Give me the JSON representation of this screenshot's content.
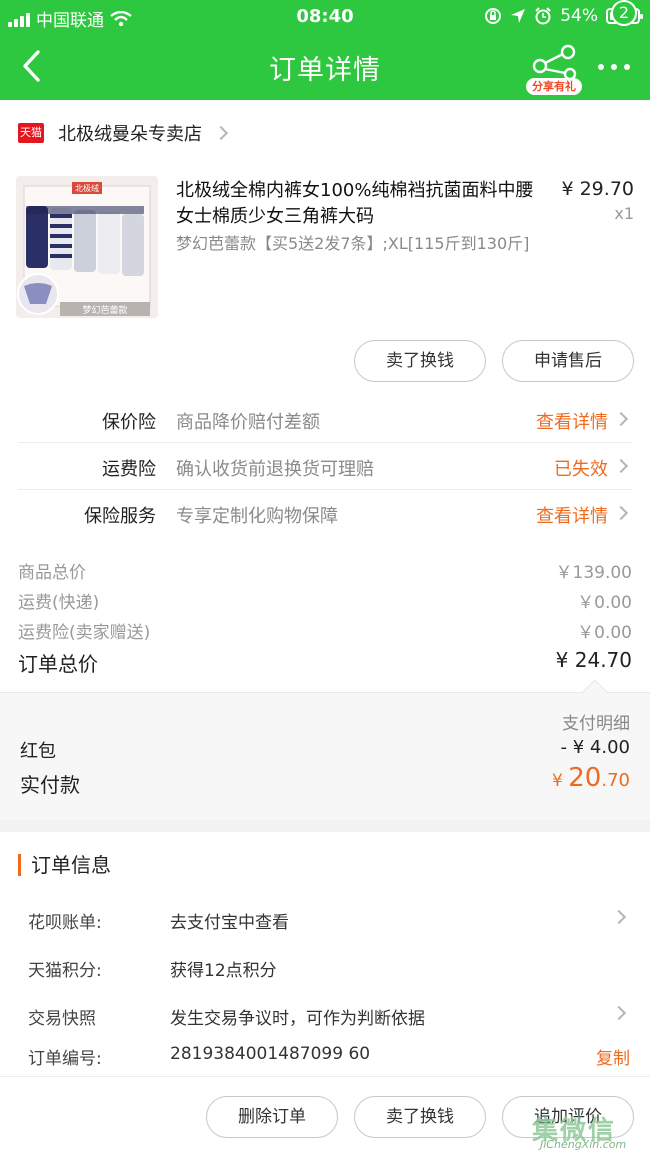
{
  "status_bar": {
    "carrier": "中国联通",
    "time": "08:40",
    "battery": "54%",
    "battery_level": 0.54
  },
  "nav": {
    "title": "订单详情",
    "share_label": "分享有礼",
    "badge": "2"
  },
  "store": {
    "badge": "天猫",
    "name": "北极绒曼朵专卖店"
  },
  "product": {
    "name": "北极绒全棉内裤女100%纯棉裆抗菌面料中腰女士棉质少女三角裤大码",
    "spec": "梦幻芭蕾款【买5送2发7条】;XL[115斤到130斤]",
    "price": "¥ 29.70",
    "qty": "x1",
    "thumb_caption": "梦幻芭蕾款",
    "box_logo": "北极绒"
  },
  "item_buttons": {
    "resell": "卖了换钱",
    "after_sale": "申请售后"
  },
  "insurance": [
    {
      "label": "保价险",
      "desc": "商品降价赔付差额",
      "action": "查看详情"
    },
    {
      "label": "运费险",
      "desc": "确认收货前退换货可理赔",
      "action": "已失效"
    },
    {
      "label": "保险服务",
      "desc": "专享定制化购物保障",
      "action": "查看详情"
    }
  ],
  "summary": {
    "goods_label": "商品总价",
    "goods_value": "￥139.00",
    "shipping_label": "运费(快递)",
    "shipping_value": "￥0.00",
    "ins_label": "运费险(卖家赠送)",
    "ins_value": "￥0.00",
    "total_label": "订单总价",
    "total_value": "¥ 24.70"
  },
  "payment": {
    "detail_label": "支付明细",
    "redpacket_label": "红包",
    "redpacket_value": "- ¥ 4.00",
    "paid_label": "实付款",
    "paid_currency": "¥ ",
    "paid_int": "20",
    "paid_dec": ".70"
  },
  "order_info": {
    "title": "订单信息",
    "rows": [
      {
        "label": "花呗账单:",
        "value": "去支付宝中查看"
      },
      {
        "label": "天猫积分:",
        "value": "获得12点积分"
      },
      {
        "label": "交易快照",
        "value": "发生交易争议时，可作为判断依据"
      },
      {
        "label": "订单编号:",
        "value": "2819384001487099 60"
      }
    ],
    "copy_label": "复制"
  },
  "bottom_bar": {
    "delete": "删除订单",
    "resell": "卖了换钱",
    "review": "追加评价"
  },
  "watermark": {
    "text": "集微信",
    "url": "JiChengXin.com"
  },
  "colors": {
    "brand_green": "#2dc83f",
    "accent_orange": "#ef6b1f",
    "tmall_red": "#e3171f"
  }
}
